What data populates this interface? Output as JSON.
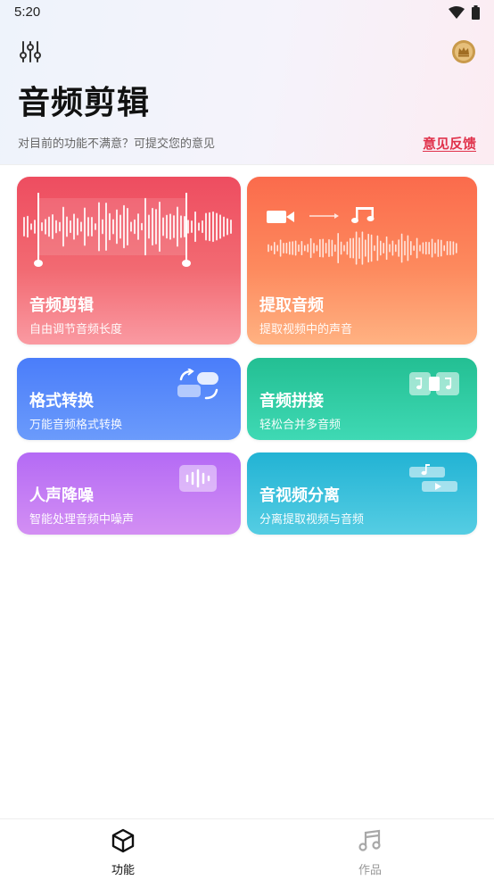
{
  "status_bar": {
    "time": "5:20"
  },
  "header": {
    "title": "音频剪辑",
    "subtitle": "对目前的功能不满意？可提交您的意见",
    "feedback_link": "意见反馈"
  },
  "colors": {
    "accent_red": "#e0324b",
    "card_edit": "#ee4d60",
    "card_extract": "#fb6b4c",
    "card_format": "#4a7dfa",
    "card_splice": "#23bf93",
    "card_noise": "#b46af5",
    "card_separate": "#22b3d4"
  },
  "cards": [
    {
      "title": "音频剪辑",
      "subtitle": "自由调节音频长度",
      "icon": "waveform-trim-icon"
    },
    {
      "title": "提取音频",
      "subtitle": "提取视频中的声音",
      "icon": "video-to-music-icon"
    },
    {
      "title": "格式转换",
      "subtitle": "万能音频格式转换",
      "icon": "convert-icon"
    },
    {
      "title": "音频拼接",
      "subtitle": "轻松合并多音频",
      "icon": "merge-icon"
    },
    {
      "title": "人声降噪",
      "subtitle": "智能处理音频中噪声",
      "icon": "voice-wave-icon"
    },
    {
      "title": "音视频分离",
      "subtitle": "分离提取视频与音频",
      "icon": "separate-icon"
    }
  ],
  "bottom_nav": [
    {
      "label": "功能",
      "icon": "cube-icon",
      "active": true
    },
    {
      "label": "作品",
      "icon": "music-note-icon",
      "active": false
    }
  ]
}
